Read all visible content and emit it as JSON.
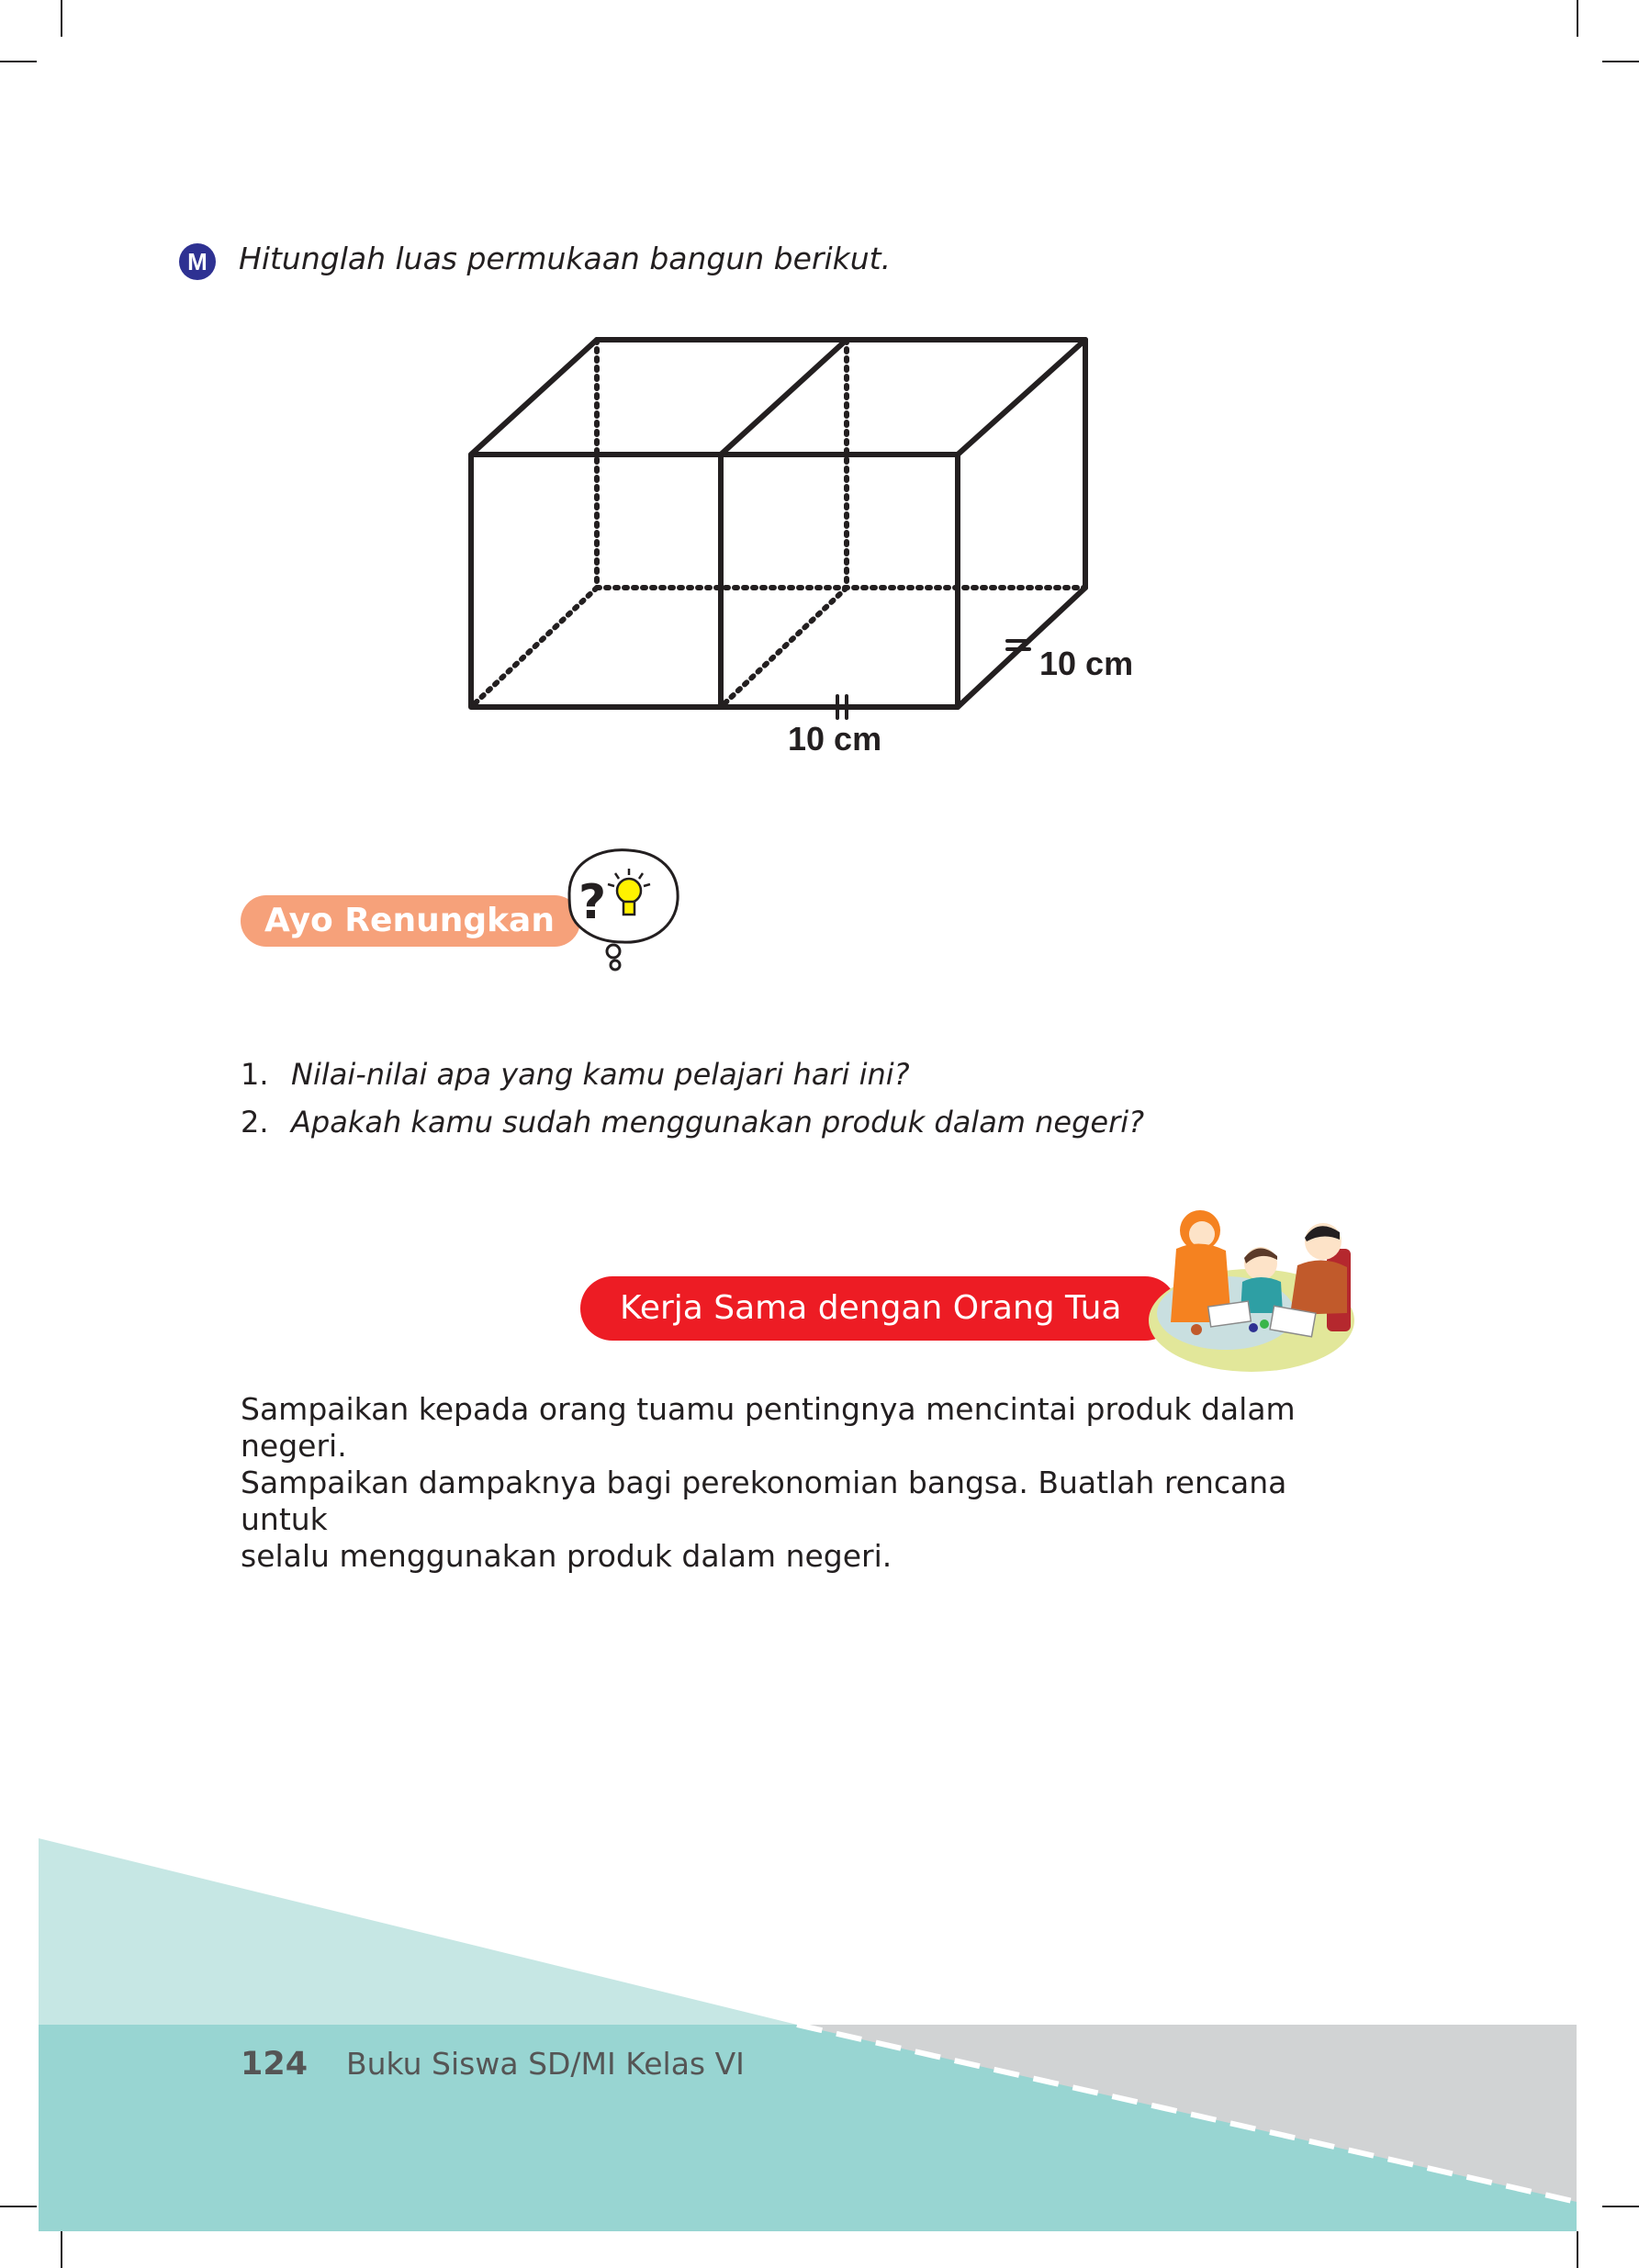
{
  "exercise": {
    "badge": "M",
    "instruction": "Hitunglah luas permukaan bangun berikut."
  },
  "figure": {
    "length_label": "10 cm",
    "depth_label": "10 cm"
  },
  "reflection": {
    "title": "Ayo Renungkan",
    "icon": "thought-bubble-question-lightbulb-icon",
    "questions": [
      {
        "num": "1.",
        "text": "Nilai-nilai apa yang kamu pelajari hari ini?"
      },
      {
        "num": "2.",
        "text": "Apakah kamu sudah menggunakan produk dalam negeri?"
      }
    ]
  },
  "parents": {
    "title": "Kerja Sama dengan Orang Tua",
    "illustration": "family-illustration",
    "lines": [
      "Sampaikan kepada orang tuamu pentingnya mencintai produk dalam negeri.",
      "Sampaikan dampaknya bagi perekonomian bangsa. Buatlah rencana untuk",
      "selalu menggunakan produk dalam negeri."
    ]
  },
  "footer": {
    "page_number": "124",
    "book_title": "Buku Siswa SD/MI Kelas VI"
  },
  "colors": {
    "badge_blue": "#2e3192",
    "ayo_orange": "#f6a17a",
    "kerja_red": "#ed1c24",
    "teal_light": "#c6e7e4",
    "teal": "#98d5d2",
    "gray": "#d1d3d4"
  }
}
